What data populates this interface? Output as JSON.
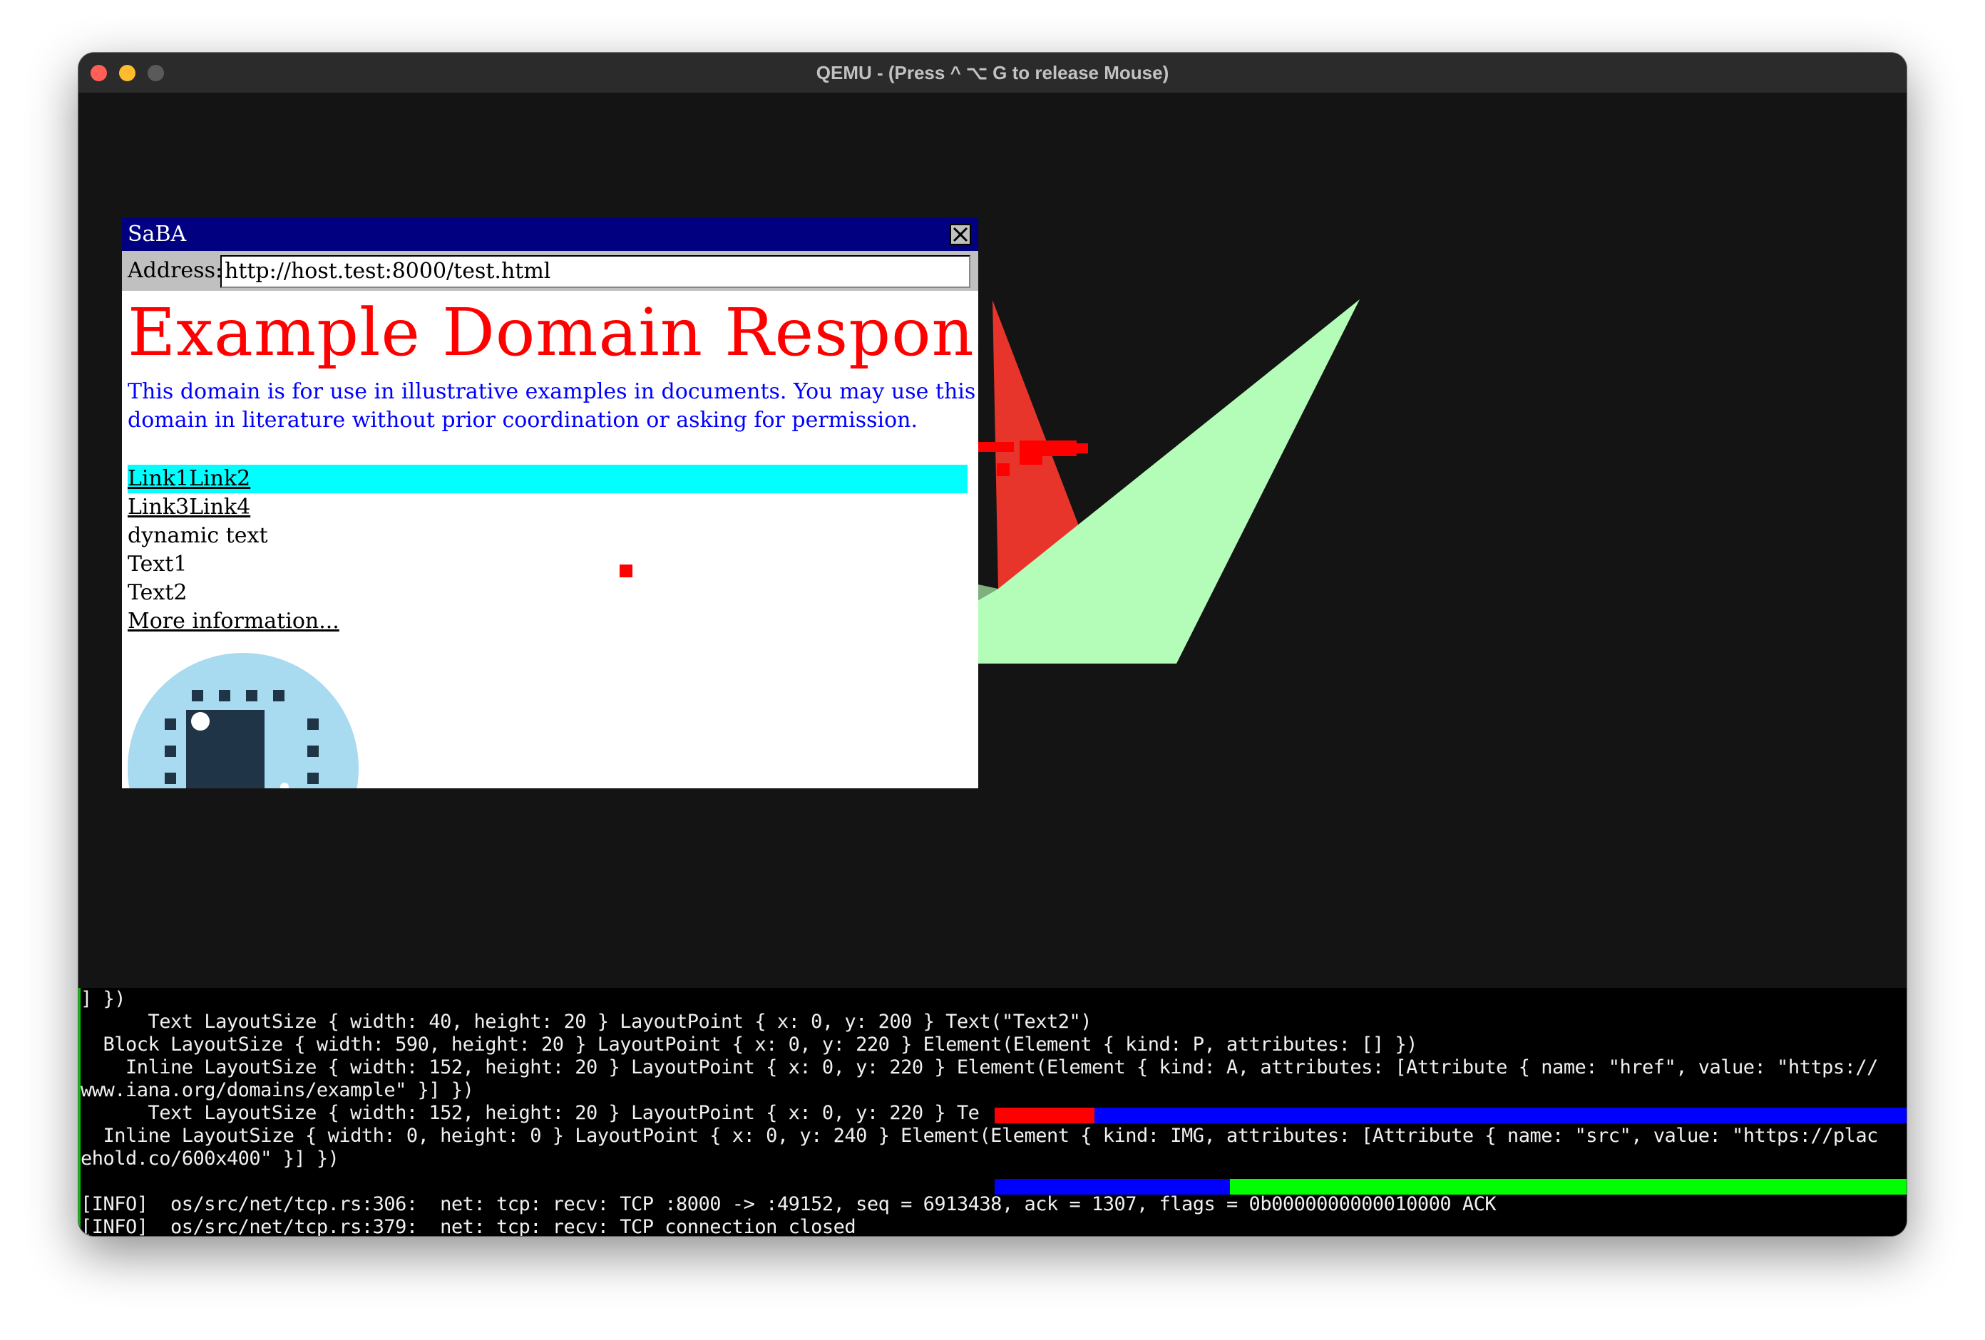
{
  "host_window": {
    "title": "QEMU - (Press ^ ⌥ G  to release Mouse)"
  },
  "browser": {
    "title": "SaBA",
    "close_icon": "close-x-icon",
    "address_label": "Address:",
    "address_value": "http://host.test:8000/test.html"
  },
  "page": {
    "heading": "Example Domain Response",
    "paragraph": "This domain is for use in illustrative examples in documents. You may use this domain in literature without prior coordination or asking for permission.",
    "links_row_1": [
      "Link1",
      "Link2"
    ],
    "links_row_2": [
      "Link3",
      "Link4"
    ],
    "dynamic_text": "dynamic text",
    "text1": "Text1",
    "text2": "Text2",
    "more_info": "More information...",
    "image_icon": "cpu-chip-icon"
  },
  "terminal": {
    "lines": [
      "] })",
      "      Text LayoutSize { width: 40, height: 20 } LayoutPoint { x: 0, y: 200 } Text(\"Text2\")",
      "  Block LayoutSize { width: 590, height: 20 } LayoutPoint { x: 0, y: 220 } Element(Element { kind: P, attributes: [] })",
      "    Inline LayoutSize { width: 152, height: 20 } LayoutPoint { x: 0, y: 220 } Element(Element { kind: A, attributes: [Attribute { name: \"href\", value: \"https://",
      "www.iana.org/domains/example\" }] })",
      "      Text LayoutSize { width: 152, height: 20 } LayoutPoint { x: 0, y: 220 } Te",
      "  Inline LayoutSize { width: 0, height: 0 } LayoutPoint { x: 0, y: 240 } Element(Element { kind: IMG, attributes: [Attribute { name: \"src\", value: \"https://plac",
      "ehold.co/600x400\" }] })",
      "",
      "[INFO]  os/src/net/tcp.rs:306:  net: tcp: recv: TCP :8000 -> :49152, seq = 6913438, ack = 1307, flags = 0b0000000000010000 ACK",
      "[INFO]  os/src/net/tcp.rs:379:  net: tcp: recv: TCP connection closed"
    ]
  },
  "colors": {
    "browser_titlebar": "#000080",
    "heading": "#ff0000",
    "paragraph": "#0000ff",
    "link_highlight": "#00ffff",
    "red_shape": "#e8352b",
    "green_shape": "#b3fdb9"
  }
}
